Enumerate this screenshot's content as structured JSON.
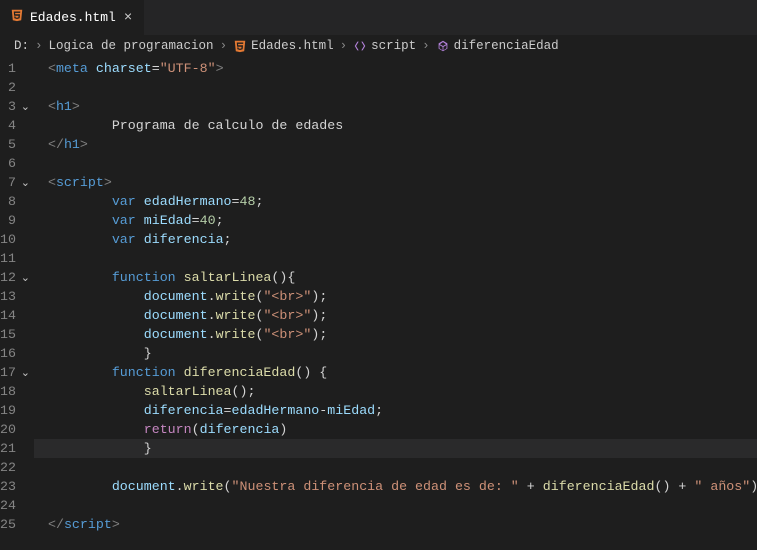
{
  "tab": {
    "filename": "Edades.html",
    "close_glyph": "×"
  },
  "breadcrumbs": {
    "root": "D:",
    "folder": "Logica de programacion",
    "file": "Edades.html",
    "symbol1": "script",
    "symbol2": "diferenciaEdad"
  },
  "code": {
    "lines": [
      {
        "n": 1,
        "fold": false,
        "tokens": [
          [
            "c-gray",
            "<"
          ],
          [
            "c-tag",
            "meta"
          ],
          [
            "c-text",
            " "
          ],
          [
            "c-attr",
            "charset"
          ],
          [
            "c-text",
            "="
          ],
          [
            "c-str",
            "\"UTF-8\""
          ],
          [
            "c-gray",
            ">"
          ]
        ],
        "indent": 0
      },
      {
        "n": 2,
        "fold": false,
        "tokens": [],
        "indent": 0
      },
      {
        "n": 3,
        "fold": true,
        "tokens": [
          [
            "c-gray",
            "<"
          ],
          [
            "c-tag",
            "h1"
          ],
          [
            "c-gray",
            ">"
          ]
        ],
        "indent": 0
      },
      {
        "n": 4,
        "fold": false,
        "tokens": [
          [
            "c-text",
            "Programa de calculo de edades"
          ]
        ],
        "indent": 2
      },
      {
        "n": 5,
        "fold": false,
        "tokens": [
          [
            "c-gray",
            "</"
          ],
          [
            "c-tag",
            "h1"
          ],
          [
            "c-gray",
            ">"
          ]
        ],
        "indent": 0
      },
      {
        "n": 6,
        "fold": false,
        "tokens": [],
        "indent": 0
      },
      {
        "n": 7,
        "fold": true,
        "tokens": [
          [
            "c-gray",
            "<"
          ],
          [
            "c-tag",
            "script"
          ],
          [
            "c-gray",
            ">"
          ]
        ],
        "indent": 0
      },
      {
        "n": 8,
        "fold": false,
        "tokens": [
          [
            "c-kw",
            "var"
          ],
          [
            "c-text",
            " "
          ],
          [
            "c-var",
            "edadHermano"
          ],
          [
            "c-text",
            "="
          ],
          [
            "c-num",
            "48"
          ],
          [
            "c-text",
            ";"
          ]
        ],
        "indent": 2
      },
      {
        "n": 9,
        "fold": false,
        "tokens": [
          [
            "c-kw",
            "var"
          ],
          [
            "c-text",
            " "
          ],
          [
            "c-var",
            "miEdad"
          ],
          [
            "c-text",
            "="
          ],
          [
            "c-num",
            "40"
          ],
          [
            "c-text",
            ";"
          ]
        ],
        "indent": 2
      },
      {
        "n": 10,
        "fold": false,
        "tokens": [
          [
            "c-kw",
            "var"
          ],
          [
            "c-text",
            " "
          ],
          [
            "c-var",
            "diferencia"
          ],
          [
            "c-text",
            ";"
          ]
        ],
        "indent": 2
      },
      {
        "n": 11,
        "fold": false,
        "tokens": [],
        "indent": 0
      },
      {
        "n": 12,
        "fold": true,
        "tokens": [
          [
            "c-kw",
            "function"
          ],
          [
            "c-text",
            " "
          ],
          [
            "c-func",
            "saltarLinea"
          ],
          [
            "c-text",
            "(){"
          ]
        ],
        "indent": 2
      },
      {
        "n": 13,
        "fold": false,
        "tokens": [
          [
            "c-var",
            "document"
          ],
          [
            "c-text",
            "."
          ],
          [
            "c-func",
            "write"
          ],
          [
            "c-text",
            "("
          ],
          [
            "c-str",
            "\"<br>\""
          ],
          [
            "c-text",
            ");"
          ]
        ],
        "indent": 3
      },
      {
        "n": 14,
        "fold": false,
        "tokens": [
          [
            "c-var",
            "document"
          ],
          [
            "c-text",
            "."
          ],
          [
            "c-func",
            "write"
          ],
          [
            "c-text",
            "("
          ],
          [
            "c-str",
            "\"<br>\""
          ],
          [
            "c-text",
            ");"
          ]
        ],
        "indent": 3
      },
      {
        "n": 15,
        "fold": false,
        "tokens": [
          [
            "c-var",
            "document"
          ],
          [
            "c-text",
            "."
          ],
          [
            "c-func",
            "write"
          ],
          [
            "c-text",
            "("
          ],
          [
            "c-str",
            "\"<br>\""
          ],
          [
            "c-text",
            ");"
          ]
        ],
        "indent": 3
      },
      {
        "n": 16,
        "fold": false,
        "tokens": [
          [
            "c-text",
            "}"
          ]
        ],
        "indent": 3
      },
      {
        "n": 17,
        "fold": true,
        "tokens": [
          [
            "c-kw",
            "function"
          ],
          [
            "c-text",
            " "
          ],
          [
            "c-func",
            "diferenciaEdad"
          ],
          [
            "c-text",
            "() {"
          ]
        ],
        "indent": 2
      },
      {
        "n": 18,
        "fold": false,
        "tokens": [
          [
            "c-func",
            "saltarLinea"
          ],
          [
            "c-text",
            "();"
          ]
        ],
        "indent": 3
      },
      {
        "n": 19,
        "fold": false,
        "tokens": [
          [
            "c-var",
            "diferencia"
          ],
          [
            "c-text",
            "="
          ],
          [
            "c-var",
            "edadHermano"
          ],
          [
            "c-text",
            "-"
          ],
          [
            "c-var",
            "miEdad"
          ],
          [
            "c-text",
            ";"
          ]
        ],
        "indent": 3
      },
      {
        "n": 20,
        "fold": false,
        "tokens": [
          [
            "c-kwctrl",
            "return"
          ],
          [
            "c-text",
            "("
          ],
          [
            "c-var",
            "diferencia"
          ],
          [
            "c-text",
            ")"
          ]
        ],
        "indent": 3
      },
      {
        "n": 21,
        "fold": false,
        "hl": true,
        "tokens": [
          [
            "c-text",
            "}"
          ]
        ],
        "indent": 3
      },
      {
        "n": 22,
        "fold": false,
        "tokens": [],
        "indent": 0
      },
      {
        "n": 23,
        "fold": false,
        "tokens": [
          [
            "c-var",
            "document"
          ],
          [
            "c-text",
            "."
          ],
          [
            "c-func",
            "write"
          ],
          [
            "c-text",
            "("
          ],
          [
            "c-str",
            "\"Nuestra diferencia de edad es de: \""
          ],
          [
            "c-text",
            " + "
          ],
          [
            "c-func",
            "diferenciaEdad"
          ],
          [
            "c-text",
            "() + "
          ],
          [
            "c-str",
            "\" años\""
          ],
          [
            "c-text",
            ");"
          ]
        ],
        "indent": 2
      },
      {
        "n": 24,
        "fold": false,
        "tokens": [],
        "indent": 0
      },
      {
        "n": 25,
        "fold": false,
        "tokens": [
          [
            "c-gray",
            "</"
          ],
          [
            "c-tag",
            "script"
          ],
          [
            "c-gray",
            ">"
          ]
        ],
        "indent": 0
      }
    ]
  },
  "indentUnit": "    "
}
